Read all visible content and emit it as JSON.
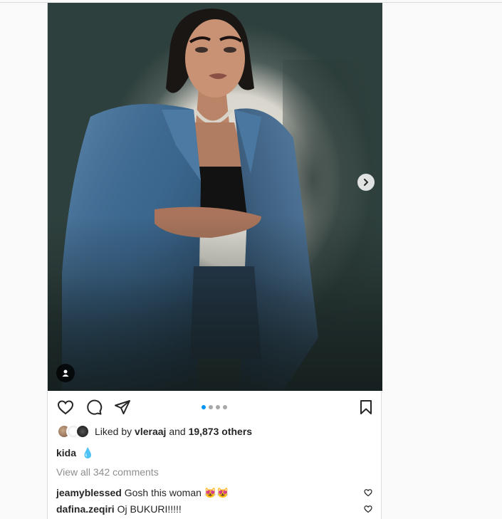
{
  "post": {
    "carousel": {
      "current": 1,
      "total": 4
    },
    "liked_by": {
      "prefix": "Liked by",
      "user": "vleraaj",
      "and": "and",
      "count": "19,873 others"
    },
    "caption": {
      "user": "kida",
      "text": "💧"
    },
    "view_all_comments": "View all 342 comments",
    "comments": [
      {
        "user": "jeamyblessed",
        "text": "Gosh this woman 😻😻"
      },
      {
        "user": "dafina.zeqiri",
        "text": "Oj BUKURI!!!!!"
      }
    ]
  },
  "icons": {
    "like": "heart-icon",
    "comment": "comment-icon",
    "share": "paper-plane-icon",
    "save": "bookmark-icon",
    "next": "chevron-right-icon",
    "tags": "user-tag-icon"
  },
  "colors": {
    "accent": "#0095f6",
    "muted": "#8e8e8e",
    "text": "#262626",
    "border": "#dbdbdb"
  }
}
